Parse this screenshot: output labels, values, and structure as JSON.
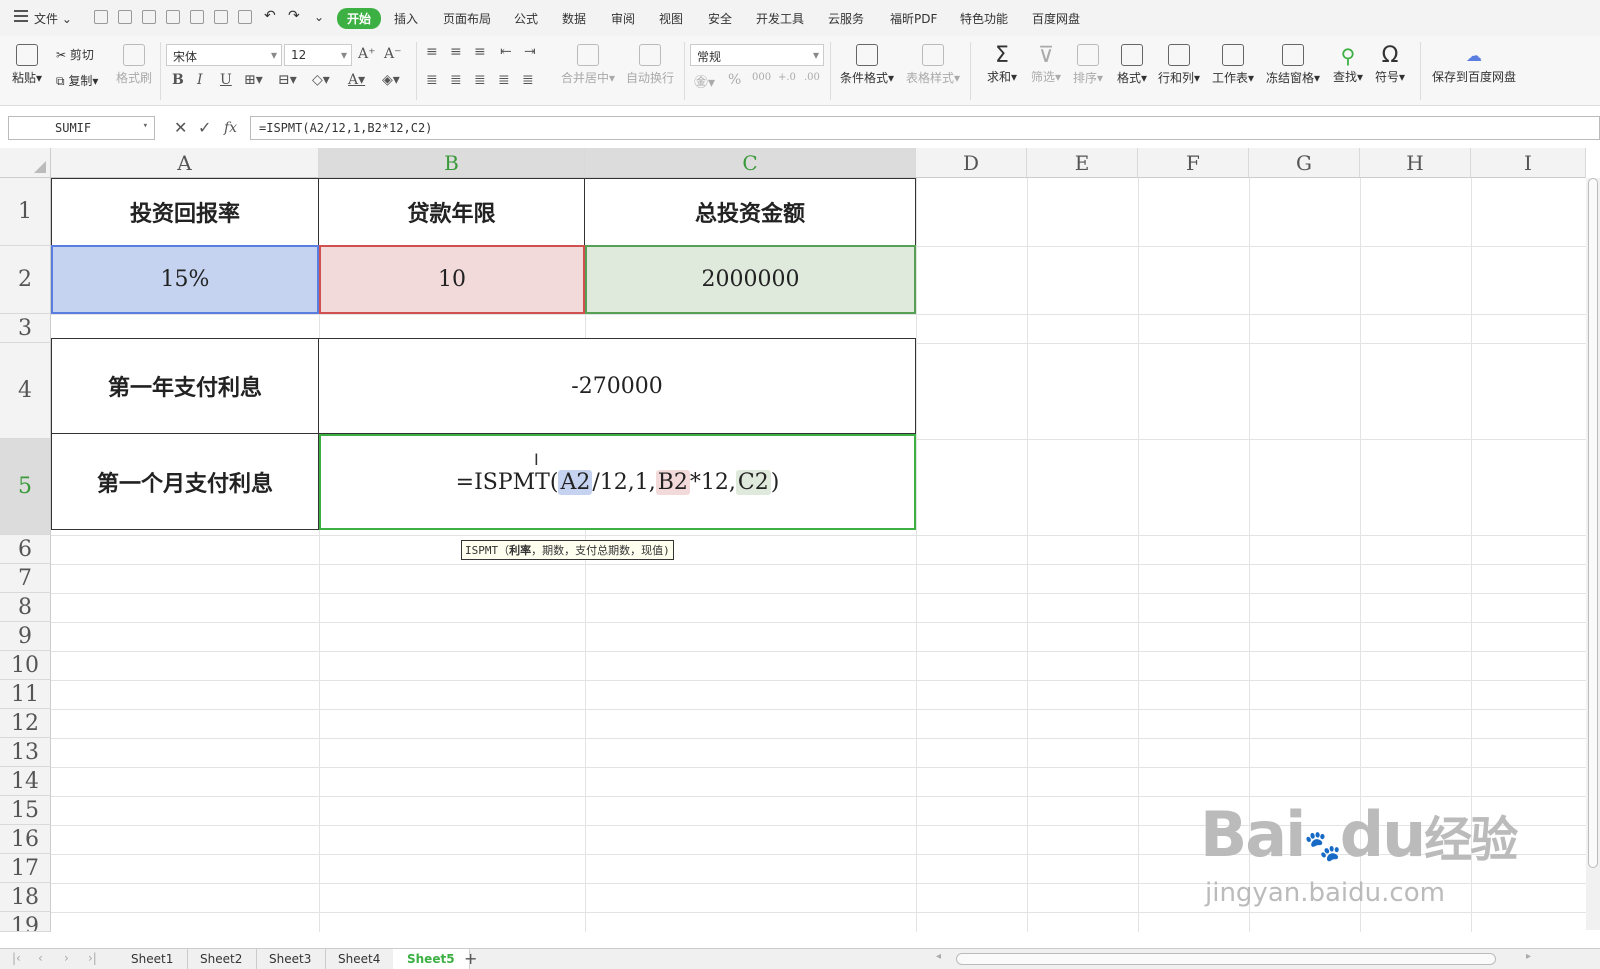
{
  "menubar": {
    "file": "文件",
    "tabs": [
      "开始",
      "插入",
      "页面布局",
      "公式",
      "数据",
      "审阅",
      "视图",
      "安全",
      "开发工具",
      "云服务",
      "福昕PDF",
      "特色功能",
      "百度网盘"
    ]
  },
  "ribbon": {
    "paste": "粘贴",
    "cut": "剪切",
    "copy": "复制",
    "format_painter": "格式刷",
    "font_name": "宋体",
    "font_size": "12",
    "merge_center": "合并居中",
    "wrap_text": "自动换行",
    "number_format": "常规",
    "conditional_format": "条件格式",
    "table_style": "表格样式",
    "sum": "求和",
    "filter": "筛选",
    "sort": "排序",
    "format": "格式",
    "rows_cols": "行和列",
    "worksheet": "工作表",
    "freeze": "冻结窗格",
    "find": "查找",
    "symbol": "符号",
    "save_baidu": "保存到百度网盘"
  },
  "formula_bar": {
    "name_box": "SUMIF",
    "fx": "fx",
    "formula": "=ISPMT(A2/12,1,B2*12,C2)"
  },
  "columns": [
    "A",
    "B",
    "C",
    "D",
    "E",
    "F",
    "G",
    "H",
    "I"
  ],
  "rows": [
    "1",
    "2",
    "3",
    "4",
    "5",
    "6",
    "7",
    "8",
    "9",
    "10",
    "11",
    "12",
    "13",
    "14",
    "15",
    "16",
    "17",
    "18",
    "19"
  ],
  "cells": {
    "a1": "投资回报率",
    "b1": "贷款年限",
    "c1": "总投资金额",
    "a2": "15%",
    "b2": "10",
    "c2": "2000000",
    "a4": "第一年支付利息",
    "b4": "-270000",
    "a5": "第一个月支付利息",
    "b5_parts": [
      "=ISPMT(",
      "A2",
      "/12,1,",
      "B2",
      "*12,",
      "C2",
      ")"
    ]
  },
  "tooltip": {
    "fn": "ISPMT（",
    "arg1": "利率",
    "rest": "，期数，支付总期数，现值)"
  },
  "sheets": [
    "Sheet1",
    "Sheet2",
    "Sheet3",
    "Sheet4",
    "Sheet5"
  ],
  "active_sheet": "Sheet5",
  "watermark": {
    "brand": "Bai",
    "brand2": "du",
    "cn": "经验",
    "url": "jingyan.baidu.com"
  },
  "colors": {
    "accent": "#3cb043",
    "a2_fill": "#c5d3f0",
    "b2_fill": "#f3dada",
    "c2_fill": "#dfe9dc"
  }
}
